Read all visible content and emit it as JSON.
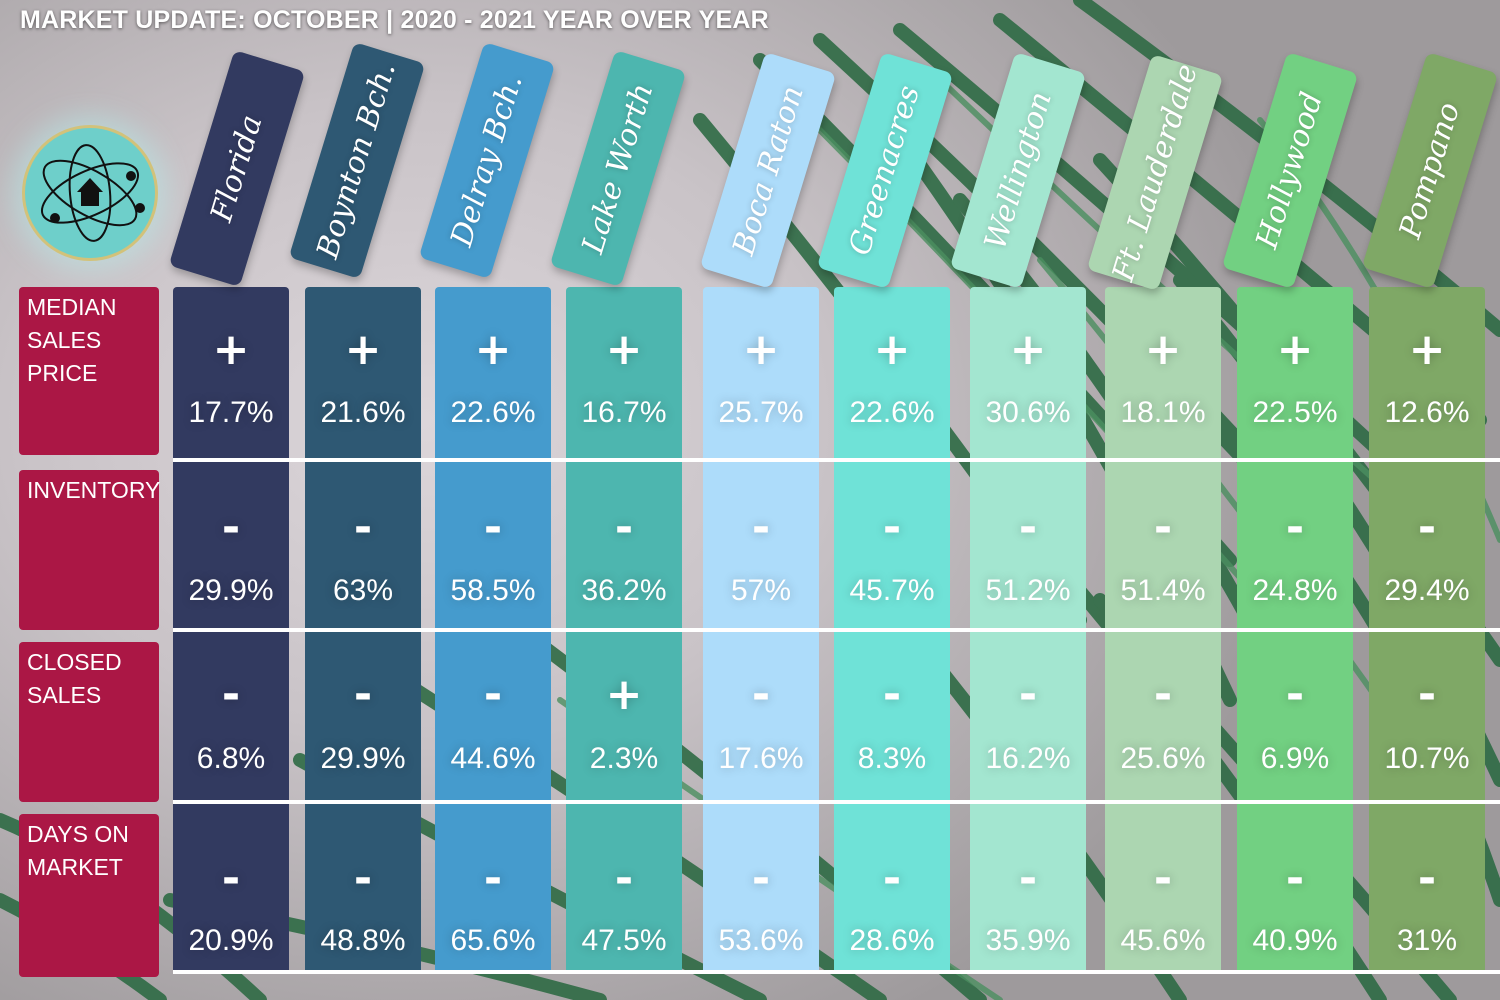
{
  "title": "MARKET UPDATE: OCTOBER | 2020 - 2021 YEAR OVER YEAR",
  "logo": {
    "icon": "atom-house-icon"
  },
  "row_labels": [
    {
      "id": "median-sales-price",
      "lines": [
        "MEDIAN",
        "SALES",
        "PRICE"
      ]
    },
    {
      "id": "inventory",
      "lines": [
        "INVENTORY"
      ]
    },
    {
      "id": "closed-sales",
      "lines": [
        "CLOSED",
        "SALES"
      ]
    },
    {
      "id": "days-on-market",
      "lines": [
        "DAYS ON",
        "MARKET"
      ]
    }
  ],
  "columns": [
    {
      "name": "Florida",
      "color": "#323a60",
      "values": [
        {
          "sign": "+",
          "value": "17.7%"
        },
        {
          "sign": "-",
          "value": "29.9%"
        },
        {
          "sign": "-",
          "value": "6.8%"
        },
        {
          "sign": "-",
          "value": "20.9%"
        }
      ]
    },
    {
      "name": "Boynton Bch.",
      "color": "#2e5873",
      "values": [
        {
          "sign": "+",
          "value": "21.6%"
        },
        {
          "sign": "-",
          "value": "63%"
        },
        {
          "sign": "-",
          "value": "29.9%"
        },
        {
          "sign": "-",
          "value": "48.8%"
        }
      ]
    },
    {
      "name": "Delray Bch.",
      "color": "#459bcd",
      "values": [
        {
          "sign": "+",
          "value": "22.6%"
        },
        {
          "sign": "-",
          "value": "58.5%"
        },
        {
          "sign": "-",
          "value": "44.6%"
        },
        {
          "sign": "-",
          "value": "65.6%"
        }
      ]
    },
    {
      "name": "Lake Worth",
      "color": "#4db6af",
      "values": [
        {
          "sign": "+",
          "value": "16.7%"
        },
        {
          "sign": "-",
          "value": "36.2%"
        },
        {
          "sign": "+",
          "value": "2.3%"
        },
        {
          "sign": "-",
          "value": "47.5%"
        }
      ]
    },
    {
      "name": "Boca Raton",
      "color": "#addcfa",
      "values": [
        {
          "sign": "+",
          "value": "25.7%"
        },
        {
          "sign": "-",
          "value": "57%"
        },
        {
          "sign": "-",
          "value": "17.6%"
        },
        {
          "sign": "-",
          "value": "53.6%"
        }
      ]
    },
    {
      "name": "Greenacres",
      "color": "#6fe2d7",
      "values": [
        {
          "sign": "+",
          "value": "22.6%"
        },
        {
          "sign": "-",
          "value": "45.7%"
        },
        {
          "sign": "-",
          "value": "8.3%"
        },
        {
          "sign": "-",
          "value": "28.6%"
        }
      ]
    },
    {
      "name": "Wellington",
      "color": "#a3e6d0",
      "values": [
        {
          "sign": "+",
          "value": "30.6%"
        },
        {
          "sign": "-",
          "value": "51.2%"
        },
        {
          "sign": "-",
          "value": "16.2%"
        },
        {
          "sign": "-",
          "value": "35.9%"
        }
      ]
    },
    {
      "name": "Ft. Lauderdale",
      "color": "#acd6b1",
      "values": [
        {
          "sign": "+",
          "value": "18.1%"
        },
        {
          "sign": "-",
          "value": "51.4%"
        },
        {
          "sign": "-",
          "value": "25.6%"
        },
        {
          "sign": "-",
          "value": "45.6%"
        }
      ]
    },
    {
      "name": "Hollywood",
      "color": "#72d082",
      "values": [
        {
          "sign": "+",
          "value": "22.5%"
        },
        {
          "sign": "-",
          "value": "24.8%"
        },
        {
          "sign": "-",
          "value": "6.9%"
        },
        {
          "sign": "-",
          "value": "40.9%"
        }
      ]
    },
    {
      "name": "Pompano",
      "color": "#7fa866",
      "values": [
        {
          "sign": "+",
          "value": "12.6%"
        },
        {
          "sign": "-",
          "value": "29.4%"
        },
        {
          "sign": "-",
          "value": "10.7%"
        },
        {
          "sign": "-",
          "value": "31%"
        }
      ]
    }
  ]
}
